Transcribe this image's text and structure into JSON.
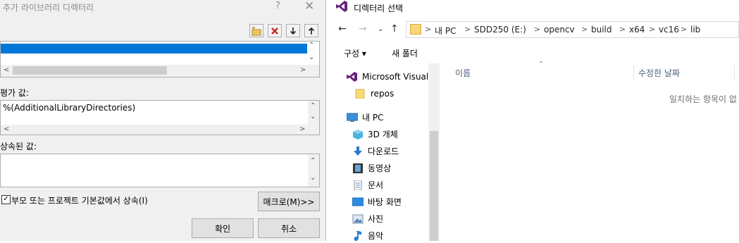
{
  "dialog": {
    "title": "추가 라이브러리 디렉터리",
    "help": "?",
    "close": "✕",
    "eval_label": "평가 값:",
    "eval_value": "%(AdditionalLibraryDirectories)",
    "inherited_label": "상속된 값:",
    "inherit_checkbox_label": "부모 또는 프로젝트 기본값에서 상속(I)",
    "inherit_checked": true,
    "macro_button": "매크로(M)>>",
    "ok_button": "확인",
    "cancel_button": "취소"
  },
  "explorer": {
    "title": "디렉터리 선택",
    "address": [
      "내 PC",
      "SDD250 (E:)",
      "opencv",
      "build",
      "x64",
      "vc16",
      "lib"
    ],
    "toolbar": {
      "organize": "구성 ▾",
      "new_folder": "새 폴더"
    },
    "nav": [
      {
        "label": "Microsoft Visual S",
        "icon": "visual-studio-icon"
      },
      {
        "label": "repos",
        "icon": "folder-icon"
      },
      {
        "label": "내 PC",
        "icon": "pc-icon"
      },
      {
        "label": "3D 개체",
        "icon": "3d-objects-icon"
      },
      {
        "label": "다운로드",
        "icon": "download-icon"
      },
      {
        "label": "동영상",
        "icon": "video-icon"
      },
      {
        "label": "문서",
        "icon": "document-icon"
      },
      {
        "label": "바탕 화면",
        "icon": "desktop-icon"
      },
      {
        "label": "사진",
        "icon": "picture-icon"
      },
      {
        "label": "음악",
        "icon": "music-icon"
      }
    ],
    "columns": {
      "name": "이름",
      "modified": "수정한 날짜"
    },
    "empty_message": "일치하는 항목이 없"
  },
  "colors": {
    "selection": "#0078d7",
    "accent_purple": "#68217a"
  }
}
